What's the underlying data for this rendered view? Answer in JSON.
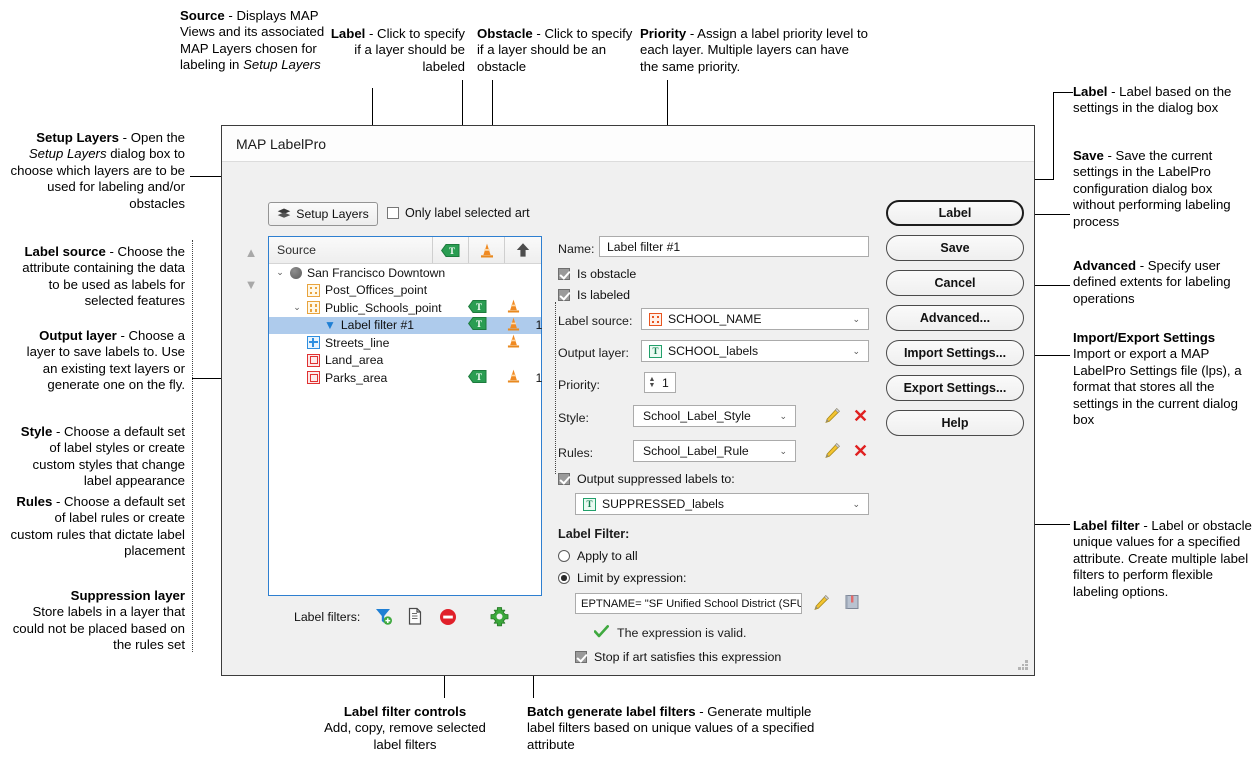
{
  "dialog": {
    "title": "MAP LabelPro",
    "setup_layers_button": "Setup Layers",
    "only_label_selected_art": "Only label selected art",
    "tree": {
      "column_source": "Source",
      "column_label_icon": "label-tag-icon",
      "column_obstacle_icon": "obstacle-cone-icon",
      "column_priority_icon": "priority-up-arrow-icon",
      "rows": [
        {
          "label": "San Francisco Downtown",
          "indent": 0,
          "icon": "globe-icon",
          "expander": "⌄",
          "is_label": false,
          "is_obstacle": false,
          "priority": ""
        },
        {
          "label": "Post_Offices_point",
          "indent": 1,
          "icon": "point-layer-icon",
          "expander": "",
          "is_label": false,
          "is_obstacle": false,
          "priority": ""
        },
        {
          "label": "Public_Schools_point",
          "indent": 1,
          "icon": "point-layer-icon",
          "expander": "⌄",
          "is_label": true,
          "is_obstacle": true,
          "priority": ""
        },
        {
          "label": "Label filter #1",
          "indent": 2,
          "icon": "filter-funnel-icon",
          "expander": "",
          "is_label": true,
          "is_obstacle": true,
          "priority": "1",
          "selected": true
        },
        {
          "label": "Streets_line",
          "indent": 1,
          "icon": "line-layer-icon",
          "expander": "",
          "is_label": false,
          "is_obstacle": true,
          "priority": ""
        },
        {
          "label": "Land_area",
          "indent": 1,
          "icon": "area-layer-icon",
          "expander": "",
          "is_label": false,
          "is_obstacle": false,
          "priority": ""
        },
        {
          "label": "Parks_area",
          "indent": 1,
          "icon": "area-layer-icon",
          "expander": "",
          "is_label": true,
          "is_obstacle": true,
          "priority": "1"
        }
      ]
    },
    "form": {
      "name_label": "Name:",
      "name_value": "Label filter #1",
      "is_obstacle": "Is obstacle",
      "is_labeled": "Is labeled",
      "label_source_label": "Label source:",
      "label_source_value": "SCHOOL_NAME",
      "output_layer_label": "Output layer:",
      "output_layer_value": "SCHOOL_labels",
      "priority_label": "Priority:",
      "priority_value": "1",
      "style_label": "Style:",
      "style_value": "School_Label_Style",
      "rules_label": "Rules:",
      "rules_value": "School_Label_Rule",
      "output_suppressed_label": "Output suppressed labels to:",
      "suppressed_layer_value": "SUPPRESSED_labels",
      "label_filter_heading": "Label Filter:",
      "apply_to_all": "Apply to all",
      "limit_by_expression": "Limit by expression:",
      "expression_value": "EPTNAME= \"SF Unified School District (SFUSD)\"",
      "expression_valid": "The expression is valid.",
      "stop_if_art": "Stop if art satisfies this expression"
    },
    "buttons": [
      {
        "label": "Label",
        "default": true
      },
      {
        "label": "Save",
        "default": false
      },
      {
        "label": "Cancel",
        "default": false
      },
      {
        "label": "Advanced...",
        "default": false
      },
      {
        "label": "Import Settings...",
        "default": false
      },
      {
        "label": "Export Settings...",
        "default": false
      },
      {
        "label": "Help",
        "default": false
      }
    ],
    "label_filters_bar": {
      "caption": "Label filters:",
      "icons": [
        "add-filter-icon",
        "copy-filter-icon",
        "remove-filter-icon",
        "batch-generate-icon"
      ]
    }
  },
  "annotations": {
    "setup_layers": {
      "title": "Setup Layers",
      "body": " - Open the ",
      "italic": "Setup Layers",
      "rest": " dialog box to choose which layers are to be used for labeling and/or obstacles"
    },
    "source": {
      "title": "Source",
      "body": " - Displays MAP Views and its associated MAP Layers chosen for labeling in ",
      "italic": "Setup Layers"
    },
    "label_col": {
      "title": "Label",
      "body": " - Click to specify if a layer should be labeled"
    },
    "obstacle_col": {
      "title": "Obstacle",
      "body": " - Click to specify if a layer should be an obstacle"
    },
    "priority_col": {
      "title": "Priority",
      "body": " - Assign a label priority level to each layer. Multiple layers can have the same priority."
    },
    "label_source": {
      "title": "Label source",
      "body": " - Choose the attribute containing the data to be used as labels for selected features"
    },
    "output_layer": {
      "title": "Output layer",
      "body": " - Choose a layer to save labels to. Use an existing text layers or generate one on the fly."
    },
    "style": {
      "title": "Style",
      "body": " - Choose a default set of label styles or create custom styles that change label appearance"
    },
    "rules": {
      "title": "Rules",
      "body": " - Choose a default set of label rules or create custom rules that dictate label placement"
    },
    "suppression": {
      "title": "Suppression layer",
      "body": "Store labels in a layer that could not be placed based on the rules set"
    },
    "label_btn": {
      "title": "Label",
      "body": " - Label based on the settings in the dialog box"
    },
    "save_btn": {
      "title": "Save",
      "body": " - Save the current settings in the LabelPro configuration dialog box without performing labeling process"
    },
    "advanced_btn": {
      "title": "Advanced",
      "body": " - Specify user defined extents for labeling operations"
    },
    "import_export": {
      "title": "Import/Export Settings",
      "body": "Import or export a MAP LabelPro Settings file (lps), a format that stores all the settings in the current dialog box"
    },
    "label_filter": {
      "title": "Label filter",
      "body": " - Label or obstacle unique values for a specified attribute. Create multiple label filters to perform flexible labeling options."
    },
    "filter_controls": {
      "title": "Label filter controls",
      "body": "Add, copy, remove selected label filters"
    },
    "batch_generate": {
      "title": "Batch generate label filters",
      "body": " - Generate multiple label filters based on unique values of a specified attribute"
    }
  },
  "colors": {
    "accent_blue": "#2e7fd0",
    "selection_blue": "#aecbec",
    "obstacle_orange": "#e8891f",
    "label_green": "#2a9d52",
    "error_red": "#e02020",
    "valid_green": "#3fa93f"
  }
}
